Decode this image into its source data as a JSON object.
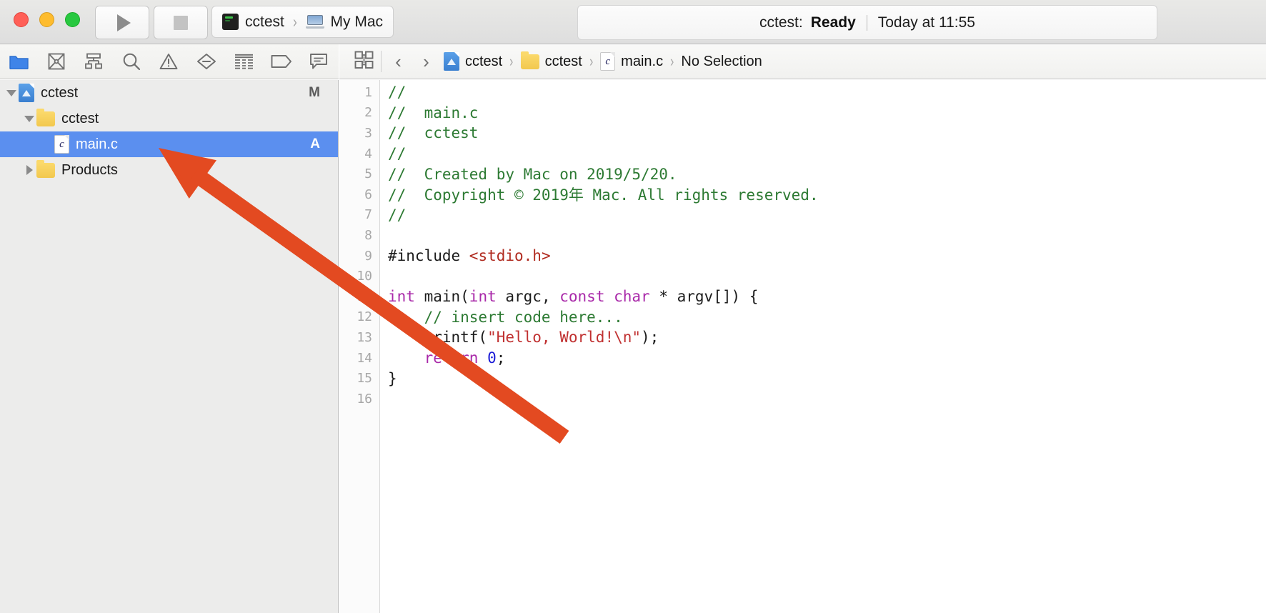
{
  "window": {
    "traffic_lights": [
      "close",
      "minimize",
      "zoom"
    ],
    "colors": {
      "close": "#ff5f57",
      "minimize": "#febc2e",
      "zoom": "#28c840",
      "selection_blue": "#5b8fef",
      "annotation_orange": "#e34a21",
      "comment_green": "#2d7a33",
      "string_red": "#c03030",
      "keyword_magenta": "#a929a9",
      "number_blue": "#1b1bd6",
      "header_brick": "#b02b20"
    }
  },
  "toolbar": {
    "run_button_label": "Run",
    "stop_button_label": "Stop",
    "scheme": {
      "scheme_name": "cctest",
      "separator": "›",
      "destination_name": "My Mac"
    },
    "status": {
      "project_prefix": "cctest:",
      "state": "Ready",
      "divider": "|",
      "timestamp": "Today at 11:55"
    }
  },
  "navigator_toolbar": {
    "icons": [
      {
        "name": "folder-icon",
        "label": "Project navigator",
        "active": true
      },
      {
        "name": "source-control-icon",
        "label": "Source control navigator",
        "active": false
      },
      {
        "name": "symbol-hierarchy-icon",
        "label": "Symbol navigator",
        "active": false
      },
      {
        "name": "search-icon",
        "label": "Find navigator",
        "active": false
      },
      {
        "name": "warning-triangle-icon",
        "label": "Issue navigator",
        "active": false
      },
      {
        "name": "test-diamond-icon",
        "label": "Test navigator",
        "active": false
      },
      {
        "name": "debug-list-icon",
        "label": "Debug navigator",
        "active": false
      },
      {
        "name": "breakpoint-tag-icon",
        "label": "Breakpoint navigator",
        "active": false
      },
      {
        "name": "report-bubble-icon",
        "label": "Report navigator",
        "active": false
      }
    ]
  },
  "jump_bar": {
    "related_items_icon": "grid-squares-icon",
    "back_arrow": "‹",
    "forward_arrow": "›",
    "chevron": "›",
    "crumbs": [
      {
        "icon": "xcodeproj-icon",
        "label": "cctest"
      },
      {
        "icon": "folder-icon",
        "label": "cctest"
      },
      {
        "icon": "c-file-icon",
        "label": "main.c"
      },
      {
        "icon": "none",
        "label": "No Selection"
      }
    ]
  },
  "sidebar": {
    "tree": [
      {
        "label": "cctest",
        "icon": "xcodeproj-icon",
        "depth": 1,
        "disclosure": "down",
        "badge": "M",
        "selected": false
      },
      {
        "label": "cctest",
        "icon": "folder-icon",
        "depth": 2,
        "disclosure": "down",
        "badge": "",
        "selected": false
      },
      {
        "label": "main.c",
        "icon": "c-file-icon",
        "depth": 3,
        "disclosure": "none",
        "badge": "A",
        "selected": true
      },
      {
        "label": "Products",
        "icon": "folder-icon",
        "depth": 2,
        "disclosure": "right",
        "badge": "",
        "selected": false
      }
    ]
  },
  "editor": {
    "lines": [
      {
        "num": "1",
        "tokens": [
          {
            "t": "//",
            "c": "comment"
          }
        ]
      },
      {
        "num": "2",
        "tokens": [
          {
            "t": "//  main.c",
            "c": "comment"
          }
        ]
      },
      {
        "num": "3",
        "tokens": [
          {
            "t": "//  cctest",
            "c": "comment"
          }
        ]
      },
      {
        "num": "4",
        "tokens": [
          {
            "t": "//",
            "c": "comment"
          }
        ]
      },
      {
        "num": "5",
        "tokens": [
          {
            "t": "//  Created by Mac on 2019/5/20.",
            "c": "comment"
          }
        ]
      },
      {
        "num": "6",
        "tokens": [
          {
            "t": "//  Copyright © 2019年 Mac. All rights reserved.",
            "c": "comment"
          }
        ]
      },
      {
        "num": "7",
        "tokens": [
          {
            "t": "//",
            "c": "comment"
          }
        ]
      },
      {
        "num": "8",
        "tokens": []
      },
      {
        "num": "9",
        "tokens": [
          {
            "t": "#include ",
            "c": "preproc"
          },
          {
            "t": "<stdio.h>",
            "c": "header"
          }
        ]
      },
      {
        "num": "10",
        "tokens": []
      },
      {
        "num": "11",
        "tokens": [
          {
            "t": "int",
            "c": "keyword"
          },
          {
            "t": " main(",
            "c": "plain"
          },
          {
            "t": "int",
            "c": "keyword"
          },
          {
            "t": " argc, ",
            "c": "plain"
          },
          {
            "t": "const",
            "c": "keyword"
          },
          {
            "t": " ",
            "c": "plain"
          },
          {
            "t": "char",
            "c": "keyword"
          },
          {
            "t": " * argv[]) {",
            "c": "plain"
          }
        ]
      },
      {
        "num": "12",
        "tokens": [
          {
            "t": "    // insert code here...",
            "c": "comment"
          }
        ]
      },
      {
        "num": "13",
        "tokens": [
          {
            "t": "    printf(",
            "c": "plain"
          },
          {
            "t": "\"Hello, World!\\n\"",
            "c": "string"
          },
          {
            "t": ");",
            "c": "plain"
          }
        ]
      },
      {
        "num": "14",
        "tokens": [
          {
            "t": "    ",
            "c": "plain"
          },
          {
            "t": "return",
            "c": "keyword"
          },
          {
            "t": " ",
            "c": "plain"
          },
          {
            "t": "0",
            "c": "number"
          },
          {
            "t": ";",
            "c": "plain"
          }
        ]
      },
      {
        "num": "15",
        "tokens": [
          {
            "t": "}",
            "c": "plain"
          }
        ]
      },
      {
        "num": "16",
        "tokens": []
      }
    ]
  },
  "annotation": {
    "type": "arrow",
    "color": "#e34a21",
    "points_from": "790,612",
    "points_to": "222,207",
    "target_description": "main.c row in project navigator"
  }
}
